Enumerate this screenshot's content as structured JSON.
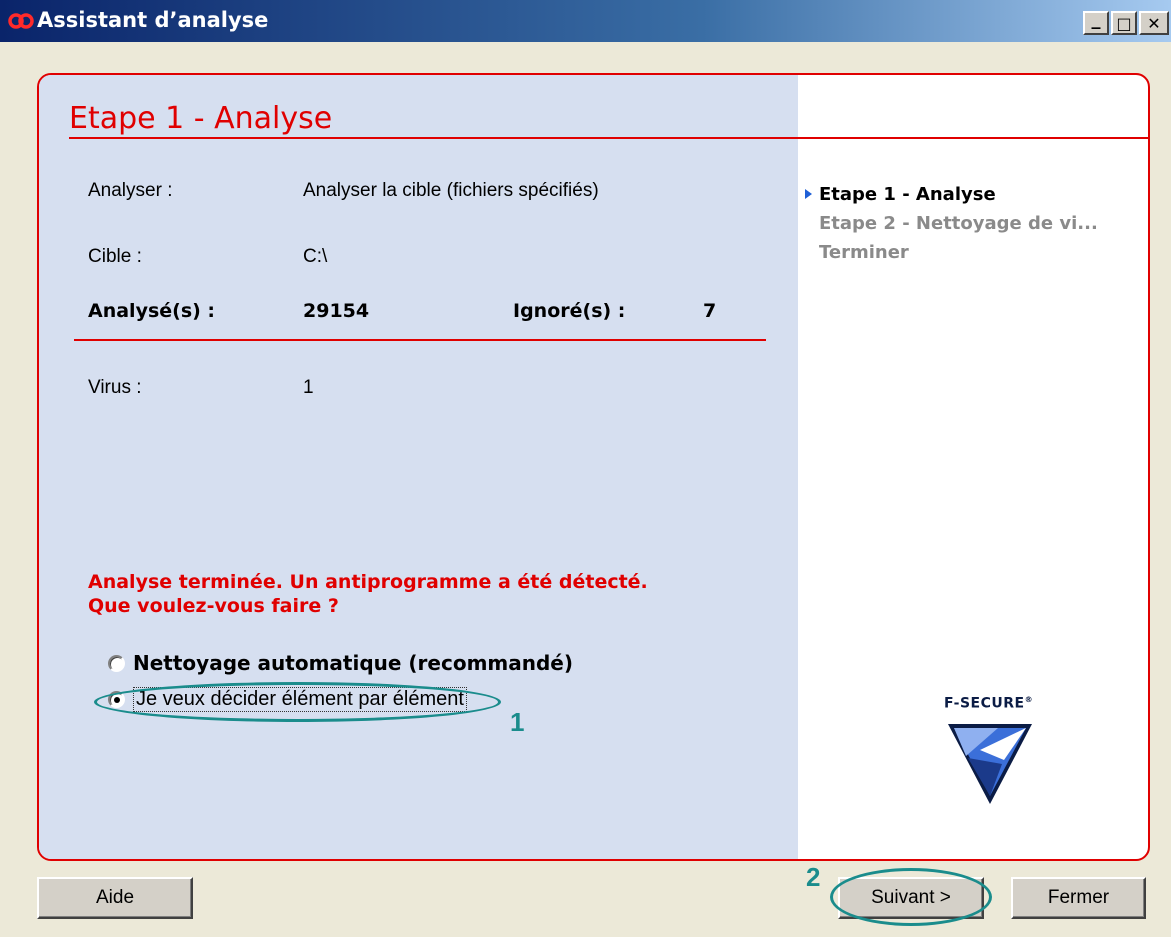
{
  "window": {
    "title": "Assistant d’analyse",
    "minimize_glyph": "_",
    "maximize_glyph": "□",
    "close_glyph": "✕"
  },
  "step": {
    "title": "Etape 1 - Analyse"
  },
  "details": {
    "analyze_label": "Analyser :",
    "analyze_value": "Analyser la cible (fichiers spécifiés)",
    "target_label": "Cible :",
    "target_value": "C:\\",
    "scanned_label": "Analysé(s) :",
    "scanned_value": "29154",
    "ignored_label": "Ignoré(s) :",
    "ignored_value": "7",
    "virus_label": "Virus :",
    "virus_value": "1"
  },
  "alert": {
    "line1": "Analyse terminée. Un antiprogramme a été détecté.",
    "line2": "Que voulez-vous faire ?"
  },
  "options": {
    "auto_label": "Nettoyage automatique (recommandé)",
    "manual_label": "Je veux décider élément par élément",
    "selected": "manual"
  },
  "steps_nav": [
    {
      "label": "Etape 1 - Analyse",
      "active": true
    },
    {
      "label": "Etape 2 - Nettoyage de vi...",
      "active": false
    },
    {
      "label": "Terminer",
      "active": false
    }
  ],
  "logo": {
    "text": "F-SECURE",
    "trademark": "®"
  },
  "annotations": {
    "marker_1": "1",
    "marker_2": "2",
    "color": "#1a8c8c"
  },
  "buttons": {
    "help": "Aide",
    "next": "Suivant >",
    "close": "Fermer"
  },
  "colors": {
    "accent_red": "#e00000",
    "pane_blue": "#d6dff0",
    "titlebar_start": "#0a246a"
  },
  "icons": {
    "app": "f-secure-app-icon",
    "logo": "f-secure-shield-logo",
    "step_marker": "triangle-right-icon"
  }
}
